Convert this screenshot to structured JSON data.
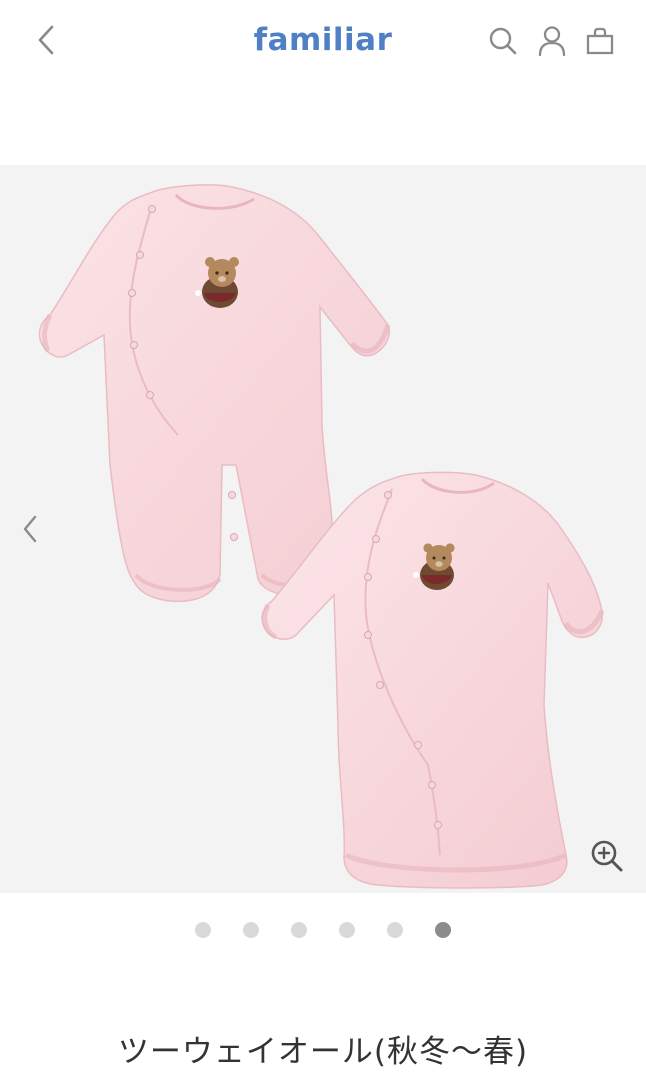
{
  "header": {
    "back_icon": "chevron-left-icon",
    "logo": "familiar",
    "logo_color": "#4f7fc4",
    "search_icon": "search-icon",
    "account_icon": "user-icon",
    "bag_icon": "shopping-bag-icon"
  },
  "gallery": {
    "background": "#f3f3f3",
    "prev_icon": "chevron-left-icon",
    "zoom_icon": "zoom-in-icon",
    "image_count": 6,
    "active_index": 6
  },
  "product": {
    "title": "ツーウェイオール(秋冬〜春)"
  }
}
